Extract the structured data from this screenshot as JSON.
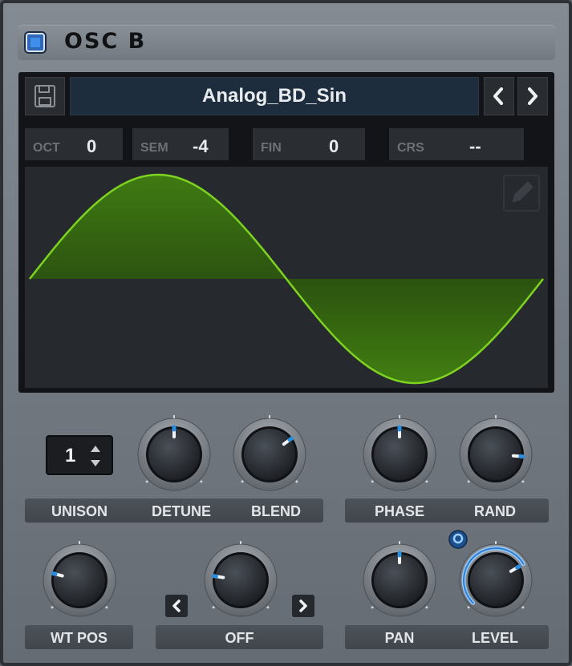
{
  "header": {
    "title": "OSC B",
    "enabled": true,
    "accent": "#2f68b8"
  },
  "wavetable": {
    "name": "Analog_BD_Sin",
    "params": [
      {
        "label": "OCT",
        "value": "0"
      },
      {
        "label": "SEM",
        "value": "-4"
      },
      {
        "label": "FIN",
        "value": "0"
      },
      {
        "label": "CRS",
        "value": "--"
      }
    ],
    "waveform": "sine",
    "wave_color": "#7ed321"
  },
  "unison": {
    "value": "1",
    "label": "UNISON"
  },
  "knobs": {
    "detune": {
      "label": "DETUNE",
      "level": 0.5
    },
    "blend": {
      "label": "BLEND",
      "level": 0.7
    },
    "phase": {
      "label": "PHASE",
      "level": 0.5
    },
    "rand": {
      "label": "RAND",
      "level": 0.85
    },
    "wt_pos": {
      "label": "WT POS",
      "level": 0.22
    },
    "warp": {
      "label": "OFF",
      "level": 0.2
    },
    "pan": {
      "label": "PAN",
      "level": 0.5
    },
    "level": {
      "label": "LEVEL",
      "level": 0.72,
      "mod_amount": 0.72
    }
  },
  "icons": [
    "save-icon",
    "prev-arrow-icon",
    "next-arrow-icon",
    "pencil-icon"
  ]
}
